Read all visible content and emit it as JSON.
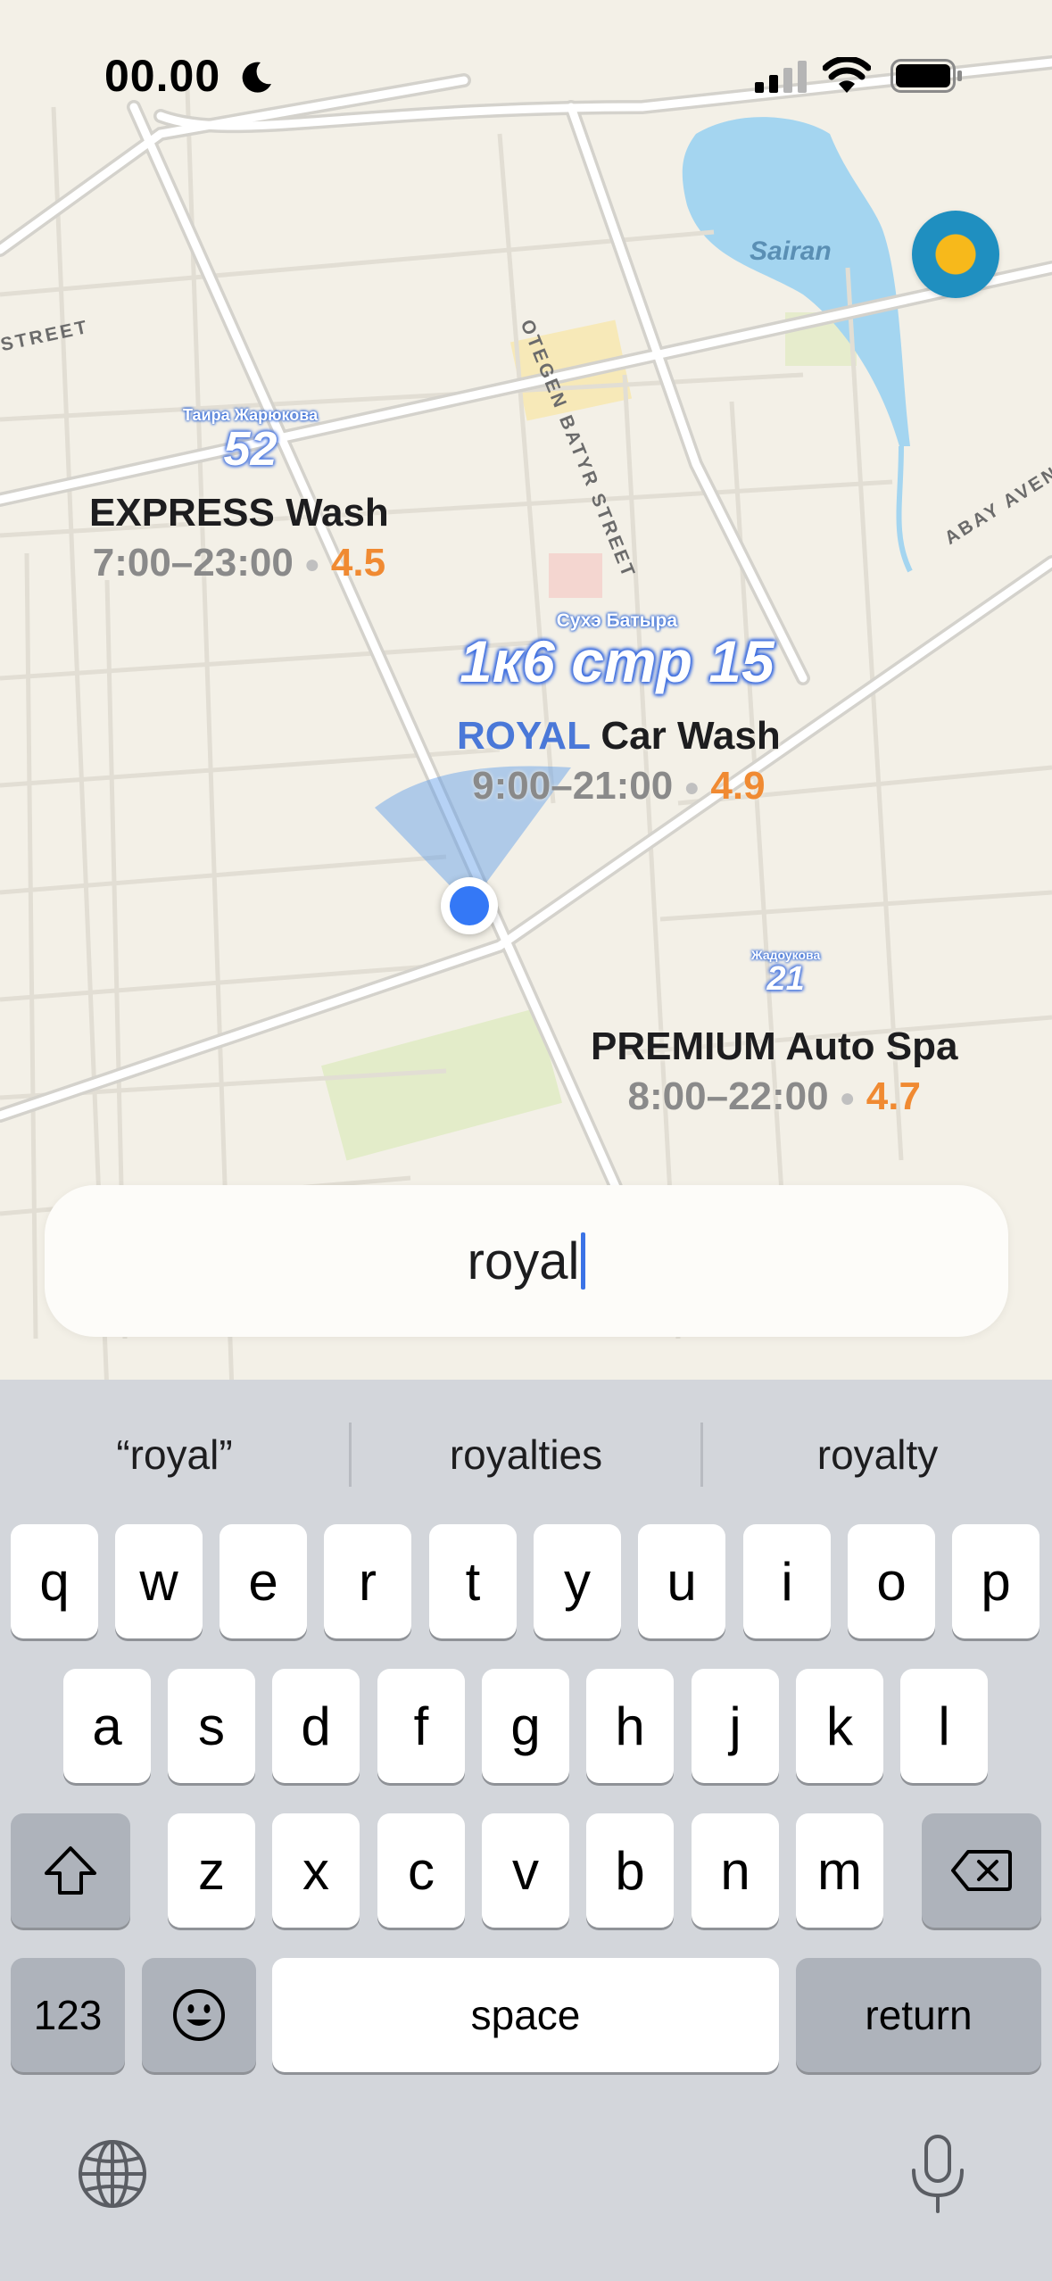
{
  "status_bar": {
    "time": "00.00",
    "icons": [
      "moon-icon",
      "signal-icon",
      "wifi-icon",
      "battery-icon"
    ]
  },
  "map": {
    "streets": [
      "STREET",
      "OTEGEN BATYR STREET",
      "ABAY AVEN"
    ],
    "lake": "Sairan",
    "districts": [
      {
        "name": "Таира Жарюкова",
        "number": "52"
      },
      {
        "name": "Сухэ Батыра",
        "number": "1к6 стр 15"
      },
      {
        "name": "Жадоукова",
        "number": "21"
      }
    ],
    "places": [
      {
        "name": "EXPRESS Wash",
        "hours": "7:00–23:00",
        "rating": "4.5"
      },
      {
        "name_highlight": "ROYAL",
        "name_rest": " Car Wash",
        "hours": "9:00–21:00",
        "rating": "4.9"
      },
      {
        "name": "PREMIUM Auto Spa",
        "hours": "8:00–22:00",
        "rating": "4.7"
      }
    ],
    "weather_icon": "sun-icon",
    "colors": {
      "rating": "#f08a32",
      "highlight": "#4a78d8",
      "location": "#3478f6",
      "water": "#a4d5f0"
    }
  },
  "search": {
    "value": "royal"
  },
  "keyboard": {
    "suggestions": [
      "“royal”",
      "royalties",
      "royalty"
    ],
    "row1": [
      "q",
      "w",
      "e",
      "r",
      "t",
      "y",
      "u",
      "i",
      "o",
      "p"
    ],
    "row2": [
      "a",
      "s",
      "d",
      "f",
      "g",
      "h",
      "j",
      "k",
      "l"
    ],
    "row3": [
      "z",
      "x",
      "c",
      "v",
      "b",
      "n",
      "m"
    ],
    "numbers_label": "123",
    "space_label": "space",
    "return_label": "return",
    "icons": [
      "shift-icon",
      "backspace-icon",
      "emoji-icon",
      "globe-icon",
      "microphone-icon"
    ]
  }
}
